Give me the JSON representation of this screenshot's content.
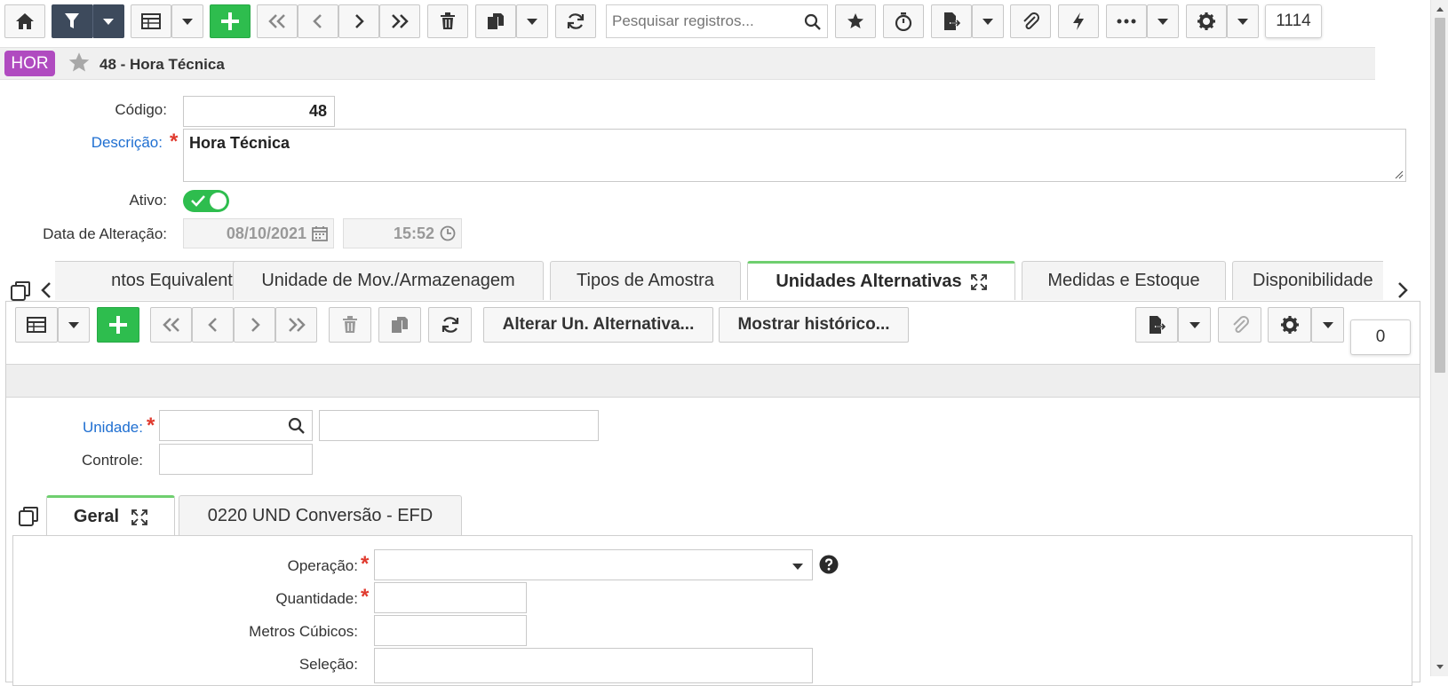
{
  "toolbar": {
    "search_placeholder": "Pesquisar registros...",
    "record_count": "1114"
  },
  "header": {
    "badge": "HOR",
    "title": "48 - Hora Técnica"
  },
  "form": {
    "codigo_label": "Código:",
    "codigo_value": "48",
    "descricao_label": "Descrição:",
    "descricao_value": "Hora Técnica",
    "ativo_label": "Ativo:",
    "data_label": "Data de Alteração:",
    "data_value": "08/10/2021",
    "hora_value": "15:52"
  },
  "tabs": [
    {
      "label": "ntos Equivalentes"
    },
    {
      "label": "Unidade de Mov./Armazenagem"
    },
    {
      "label": "Tipos de Amostra"
    },
    {
      "label": "Unidades Alternativas"
    },
    {
      "label": "Medidas e Estoque"
    },
    {
      "label": "Disponibilidade"
    }
  ],
  "subtoolbar": {
    "alterar_label": "Alterar Un. Alternativa...",
    "historico_label": "Mostrar histórico...",
    "count": "0"
  },
  "subform": {
    "unidade_label": "Unidade:",
    "controle_label": "Controle:"
  },
  "innertabs": [
    {
      "label": "Geral"
    },
    {
      "label": "0220 UND Conversão - EFD"
    }
  ],
  "geral": {
    "operacao_label": "Operação:",
    "quantidade_label": "Quantidade:",
    "metros_label": "Metros Cúbicos:",
    "selecao_label": "Seleção:"
  },
  "colors": {
    "accent_green": "#2ebd4e",
    "badge_purple": "#b04bc0",
    "link_blue": "#1f6fd1",
    "required_red": "#e03a2e"
  }
}
